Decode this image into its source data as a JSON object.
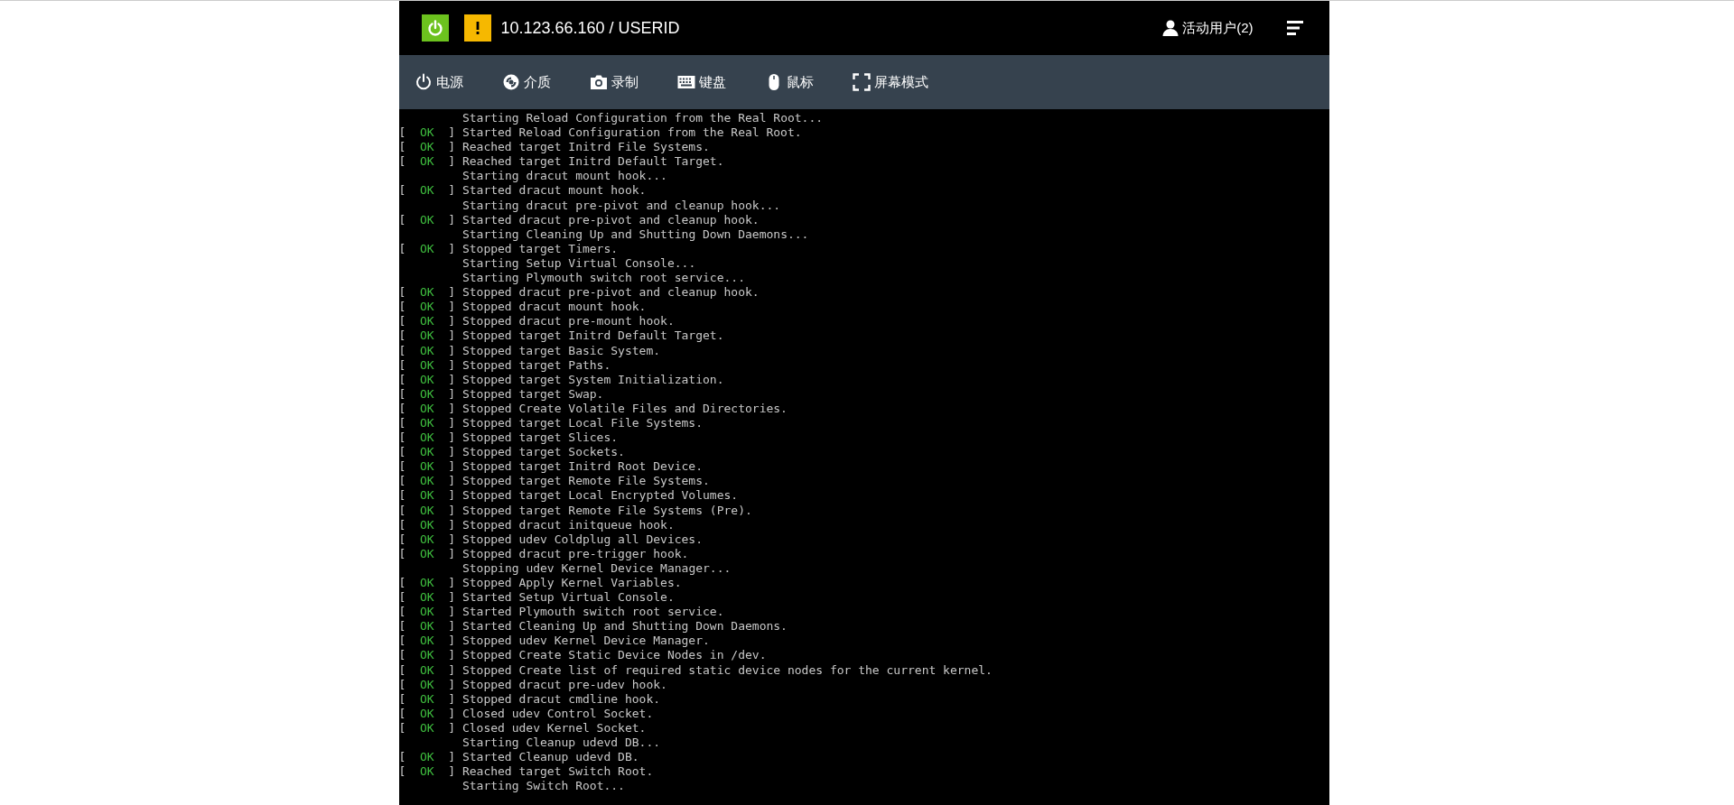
{
  "header": {
    "title": "10.123.66.160 / USERID",
    "users": "活动用户(2)"
  },
  "toolbar": [
    {
      "kind": "power",
      "label": "电源"
    },
    {
      "kind": "media",
      "label": "介质"
    },
    {
      "kind": "record",
      "label": "录制"
    },
    {
      "kind": "keyboard",
      "label": "键盘"
    },
    {
      "kind": "mouse",
      "label": "鼠标"
    },
    {
      "kind": "screen",
      "label": "屏幕模式"
    }
  ],
  "console": [
    {
      "message": "Starting Reload Configuration from the Real Root..."
    },
    {
      "status": {
        "open": "[",
        "label": "OK",
        "close": "]"
      },
      "message": "Started Reload Configuration from the Real Root."
    },
    {
      "status": {
        "open": "[",
        "label": "OK",
        "close": "]"
      },
      "message": "Reached target Initrd File Systems."
    },
    {
      "status": {
        "open": "[",
        "label": "OK",
        "close": "]"
      },
      "message": "Reached target Initrd Default Target."
    },
    {
      "message": "Starting dracut mount hook..."
    },
    {
      "status": {
        "open": "[",
        "label": "OK",
        "close": "]"
      },
      "message": "Started dracut mount hook."
    },
    {
      "message": "Starting dracut pre-pivot and cleanup hook..."
    },
    {
      "status": {
        "open": "[",
        "label": "OK",
        "close": "]"
      },
      "message": "Started dracut pre-pivot and cleanup hook."
    },
    {
      "message": "Starting Cleaning Up and Shutting Down Daemons..."
    },
    {
      "status": {
        "open": "[",
        "label": "OK",
        "close": "]"
      },
      "message": "Stopped target Timers."
    },
    {
      "message": "Starting Setup Virtual Console..."
    },
    {
      "message": "Starting Plymouth switch root service..."
    },
    {
      "status": {
        "open": "[",
        "label": "OK",
        "close": "]"
      },
      "message": "Stopped dracut pre-pivot and cleanup hook."
    },
    {
      "status": {
        "open": "[",
        "label": "OK",
        "close": "]"
      },
      "message": "Stopped dracut mount hook."
    },
    {
      "status": {
        "open": "[",
        "label": "OK",
        "close": "]"
      },
      "message": "Stopped dracut pre-mount hook."
    },
    {
      "status": {
        "open": "[",
        "label": "OK",
        "close": "]"
      },
      "message": "Stopped target Initrd Default Target."
    },
    {
      "status": {
        "open": "[",
        "label": "OK",
        "close": "]"
      },
      "message": "Stopped target Basic System."
    },
    {
      "status": {
        "open": "[",
        "label": "OK",
        "close": "]"
      },
      "message": "Stopped target Paths."
    },
    {
      "status": {
        "open": "[",
        "label": "OK",
        "close": "]"
      },
      "message": "Stopped target System Initialization."
    },
    {
      "status": {
        "open": "[",
        "label": "OK",
        "close": "]"
      },
      "message": "Stopped target Swap."
    },
    {
      "status": {
        "open": "[",
        "label": "OK",
        "close": "]"
      },
      "message": "Stopped Create Volatile Files and Directories."
    },
    {
      "status": {
        "open": "[",
        "label": "OK",
        "close": "]"
      },
      "message": "Stopped target Local File Systems."
    },
    {
      "status": {
        "open": "[",
        "label": "OK",
        "close": "]"
      },
      "message": "Stopped target Slices."
    },
    {
      "status": {
        "open": "[",
        "label": "OK",
        "close": "]"
      },
      "message": "Stopped target Sockets."
    },
    {
      "status": {
        "open": "[",
        "label": "OK",
        "close": "]"
      },
      "message": "Stopped target Initrd Root Device."
    },
    {
      "status": {
        "open": "[",
        "label": "OK",
        "close": "]"
      },
      "message": "Stopped target Remote File Systems."
    },
    {
      "status": {
        "open": "[",
        "label": "OK",
        "close": "]"
      },
      "message": "Stopped target Local Encrypted Volumes."
    },
    {
      "status": {
        "open": "[",
        "label": "OK",
        "close": "]"
      },
      "message": "Stopped target Remote File Systems (Pre)."
    },
    {
      "status": {
        "open": "[",
        "label": "OK",
        "close": "]"
      },
      "message": "Stopped dracut initqueue hook."
    },
    {
      "status": {
        "open": "[",
        "label": "OK",
        "close": "]"
      },
      "message": "Stopped udev Coldplug all Devices."
    },
    {
      "status": {
        "open": "[",
        "label": "OK",
        "close": "]"
      },
      "message": "Stopped dracut pre-trigger hook."
    },
    {
      "message": "Stopping udev Kernel Device Manager..."
    },
    {
      "status": {
        "open": "[",
        "label": "OK",
        "close": "]"
      },
      "message": "Stopped Apply Kernel Variables."
    },
    {
      "status": {
        "open": "[",
        "label": "OK",
        "close": "]"
      },
      "message": "Started Setup Virtual Console."
    },
    {
      "status": {
        "open": "[",
        "label": "OK",
        "close": "]"
      },
      "message": "Started Plymouth switch root service."
    },
    {
      "status": {
        "open": "[",
        "label": "OK",
        "close": "]"
      },
      "message": "Started Cleaning Up and Shutting Down Daemons."
    },
    {
      "status": {
        "open": "[",
        "label": "OK",
        "close": "]"
      },
      "message": "Stopped udev Kernel Device Manager."
    },
    {
      "status": {
        "open": "[",
        "label": "OK",
        "close": "]"
      },
      "message": "Stopped Create Static Device Nodes in /dev."
    },
    {
      "status": {
        "open": "[",
        "label": "OK",
        "close": "]"
      },
      "message": "Stopped Create list of required static device nodes for the current kernel."
    },
    {
      "status": {
        "open": "[",
        "label": "OK",
        "close": "]"
      },
      "message": "Stopped dracut pre-udev hook."
    },
    {
      "status": {
        "open": "[",
        "label": "OK",
        "close": "]"
      },
      "message": "Stopped dracut cmdline hook."
    },
    {
      "status": {
        "open": "[",
        "label": "OK",
        "close": "]"
      },
      "message": "Closed udev Control Socket."
    },
    {
      "status": {
        "open": "[",
        "label": "OK",
        "close": "]"
      },
      "message": "Closed udev Kernel Socket."
    },
    {
      "message": "Starting Cleanup udevd DB..."
    },
    {
      "status": {
        "open": "[",
        "label": "OK",
        "close": "]"
      },
      "message": "Started Cleanup udevd DB."
    },
    {
      "status": {
        "open": "[",
        "label": "OK",
        "close": "]"
      },
      "message": "Reached target Switch Root."
    },
    {
      "message": "Starting Switch Root..."
    }
  ]
}
